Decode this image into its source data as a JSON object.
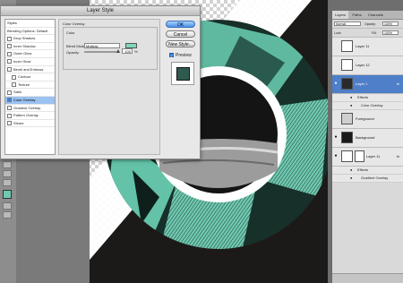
{
  "dialog": {
    "title": "Layer Style",
    "styles_list": [
      {
        "label": "Styles",
        "checkbox": false,
        "selected": false,
        "sub": false
      },
      {
        "label": "Blending Options: Default",
        "checkbox": false,
        "selected": false,
        "sub": false
      },
      {
        "label": "Drop Shadow",
        "checkbox": true,
        "selected": false,
        "sub": false
      },
      {
        "label": "Inner Shadow",
        "checkbox": true,
        "selected": false,
        "sub": false
      },
      {
        "label": "Outer Glow",
        "checkbox": true,
        "selected": false,
        "sub": false
      },
      {
        "label": "Inner Glow",
        "checkbox": true,
        "selected": false,
        "sub": false
      },
      {
        "label": "Bevel and Emboss",
        "checkbox": true,
        "selected": false,
        "sub": false
      },
      {
        "label": "Contour",
        "checkbox": true,
        "selected": false,
        "sub": true
      },
      {
        "label": "Texture",
        "checkbox": true,
        "selected": false,
        "sub": true
      },
      {
        "label": "Satin",
        "checkbox": true,
        "selected": false,
        "sub": false
      },
      {
        "label": "Color Overlay",
        "checkbox": true,
        "selected": true,
        "sub": false
      },
      {
        "label": "Gradient Overlay",
        "checkbox": true,
        "selected": false,
        "sub": false
      },
      {
        "label": "Pattern Overlay",
        "checkbox": true,
        "selected": false,
        "sub": false
      },
      {
        "label": "Stroke",
        "checkbox": true,
        "selected": false,
        "sub": false
      }
    ],
    "panel": {
      "section_title": "Color Overlay",
      "group_title": "Color",
      "blend_mode_label": "Blend Mode:",
      "blend_mode_value": "Multiply",
      "opacity_label": "Opacity:",
      "opacity_value": "100",
      "opacity_unit": "%",
      "overlay_color": "#7ed7bd"
    },
    "buttons": {
      "ok": "OK",
      "cancel": "Cancel",
      "new_style": "New Style...",
      "preview": "Preview"
    }
  },
  "layers_panel": {
    "tabs": [
      "Layers",
      "Paths",
      "Channels"
    ],
    "blend_mode": "Normal",
    "opacity_label": "Opacity:",
    "opacity_value": "100%",
    "lock_label": "Lock:",
    "fill_label": "Fill:",
    "fill_value": "100%",
    "layers": [
      {
        "name": "Layer 11",
        "visible": false,
        "selected": false,
        "thumb": "#ffffff"
      },
      {
        "name": "Layer 12",
        "visible": false,
        "selected": false,
        "thumb": "#ffffff"
      },
      {
        "name": "Layer 1",
        "visible": true,
        "selected": true,
        "thumb": "#2a2a2a",
        "fx": true
      },
      {
        "name": "Foreground",
        "visible": false,
        "selected": false,
        "thumb": "#cfcfcf"
      },
      {
        "name": "Background",
        "visible": true,
        "selected": false,
        "thumb": "#1a1a1a"
      },
      {
        "name": "Layer 11",
        "visible": true,
        "selected": false,
        "thumb": "#ffffff",
        "fx": true
      }
    ],
    "effects_label": "Effects",
    "color_overlay_effect": "Color Overlay",
    "gradient_overlay_effect": "Gradient Overlay"
  },
  "colors": {
    "accent_teal": "#6fc9b0",
    "dark_fill": "#1c1a18",
    "selection_blue": "#4e7fc8"
  }
}
